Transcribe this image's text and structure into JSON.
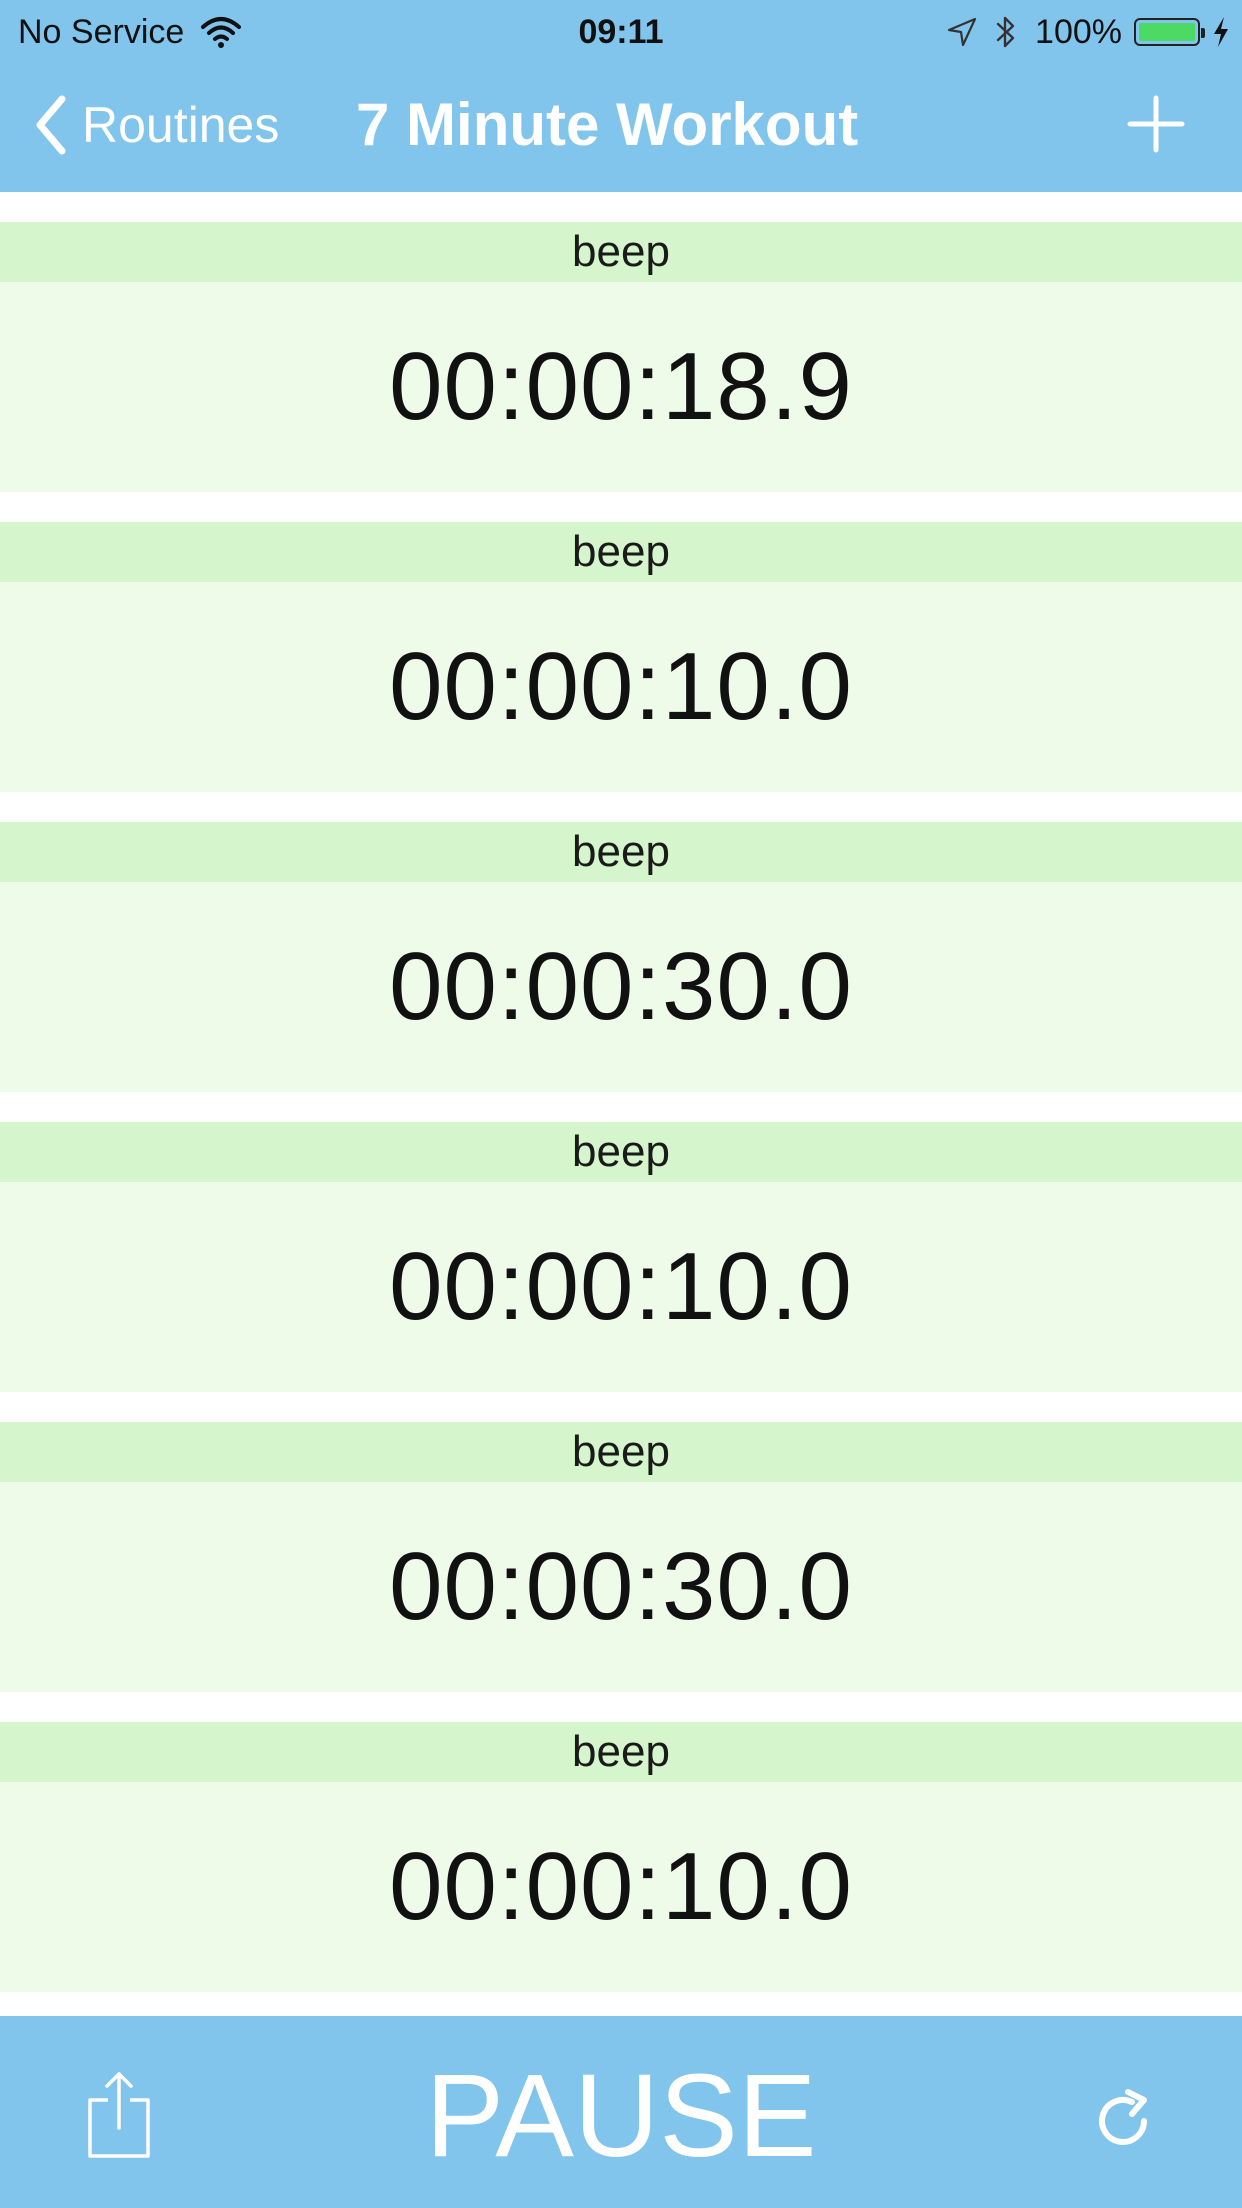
{
  "status_bar": {
    "carrier": "No Service",
    "time": "09:11",
    "battery_percent": "100%",
    "battery_level": 1.0,
    "icons": [
      "wifi-icon",
      "location-icon",
      "bluetooth-icon",
      "battery-icon",
      "charging-icon"
    ]
  },
  "nav": {
    "back_label": "Routines",
    "title": "7 Minute Workout",
    "add_icon": "plus-icon"
  },
  "timers": [
    {
      "label": "beep",
      "time": "00:00:18.9"
    },
    {
      "label": "beep",
      "time": "00:00:10.0"
    },
    {
      "label": "beep",
      "time": "00:00:30.0"
    },
    {
      "label": "beep",
      "time": "00:00:10.0"
    },
    {
      "label": "beep",
      "time": "00:00:30.0"
    },
    {
      "label": "beep",
      "time": "00:00:10.0"
    }
  ],
  "toolbar": {
    "share_icon": "share-icon",
    "pause_label": "PAUSE",
    "refresh_icon": "refresh-icon"
  },
  "colors": {
    "bar": "#81c4ec",
    "label_band": "#d5f5cc",
    "time_band": "#edfbe8",
    "battery_fill": "#4cd964"
  }
}
